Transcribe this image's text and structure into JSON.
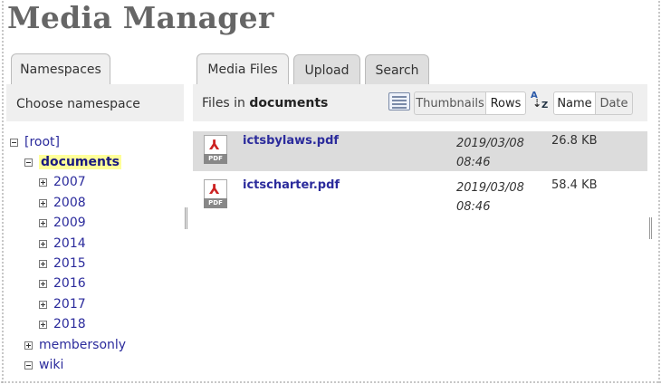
{
  "title": "Media Manager",
  "namespaces": {
    "tab_label": "Namespaces",
    "header": "Choose namespace",
    "tree": [
      {
        "label": "[root]",
        "state": "open",
        "level": 0
      },
      {
        "label": "documents",
        "state": "open",
        "level": 1,
        "selected": true
      },
      {
        "label": "2007",
        "state": "closed",
        "level": 2
      },
      {
        "label": "2008",
        "state": "closed",
        "level": 2
      },
      {
        "label": "2009",
        "state": "closed",
        "level": 2
      },
      {
        "label": "2014",
        "state": "closed",
        "level": 2
      },
      {
        "label": "2015",
        "state": "closed",
        "level": 2
      },
      {
        "label": "2016",
        "state": "closed",
        "level": 2
      },
      {
        "label": "2017",
        "state": "closed",
        "level": 2
      },
      {
        "label": "2018",
        "state": "closed",
        "level": 2
      },
      {
        "label": "membersonly",
        "state": "closed",
        "level": 1
      },
      {
        "label": "wiki",
        "state": "open",
        "level": 1
      }
    ]
  },
  "media": {
    "tabs": [
      {
        "label": "Media Files",
        "active": true
      },
      {
        "label": "Upload",
        "active": false
      },
      {
        "label": "Search",
        "active": false
      }
    ],
    "files_in_prefix": "Files in",
    "current_namespace": "documents",
    "view_options": {
      "thumbnails": "Thumbnails",
      "rows": "Rows",
      "selected": "Rows"
    },
    "sort_options": {
      "name": "Name",
      "date": "Date",
      "selected": "Name"
    },
    "files": [
      {
        "name": "ictsbylaws.pdf",
        "date": "2019/03/08",
        "time": "08:46",
        "size": "26.8 KB",
        "icon_label": "PDF"
      },
      {
        "name": "ictscharter.pdf",
        "date": "2019/03/08",
        "time": "08:46",
        "size": "58.4 KB",
        "icon_label": "PDF"
      }
    ]
  },
  "colors": {
    "link": "#2b2b9c",
    "selected_bg": "#ffff99",
    "panel_header": "#efefef",
    "row_highlight": "#dcdcdc"
  }
}
